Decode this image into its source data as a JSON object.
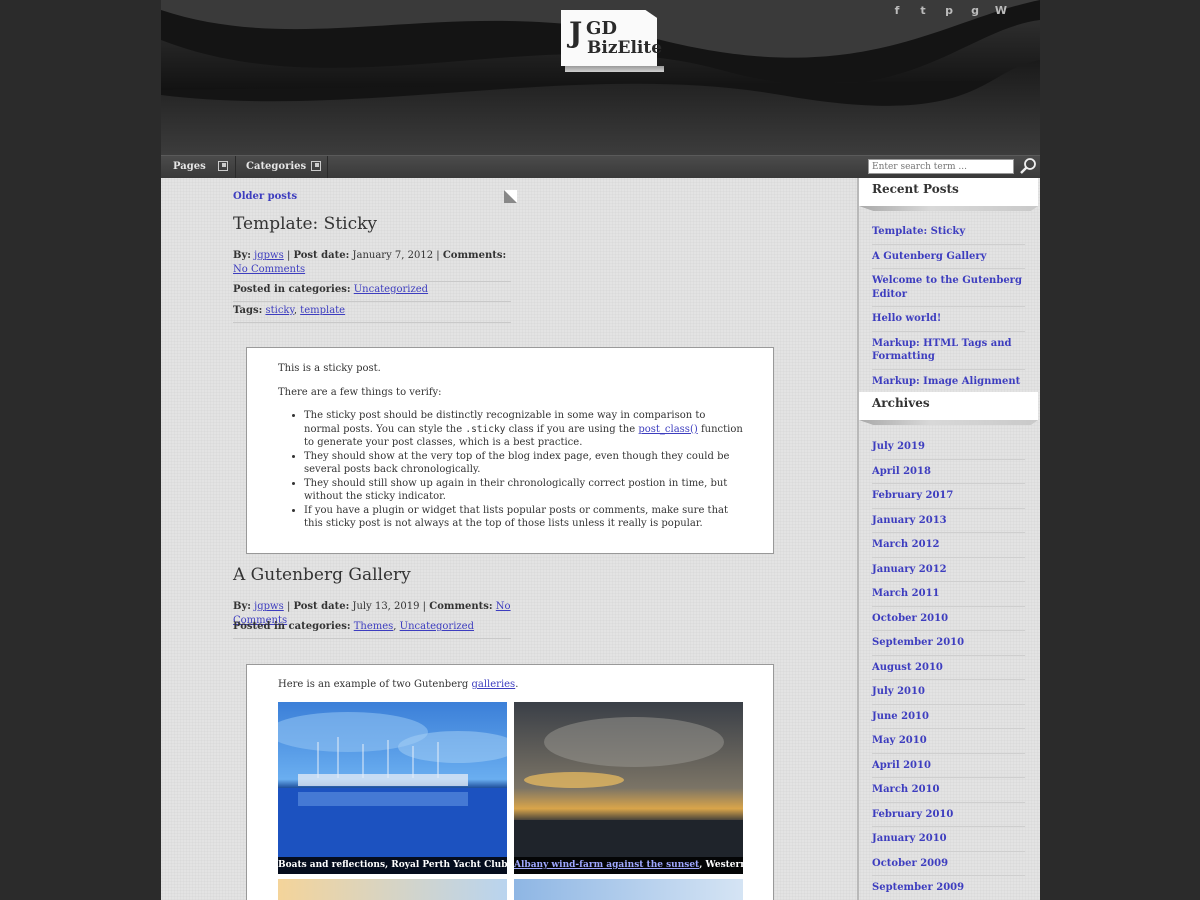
{
  "logo": {
    "j": "J",
    "gd": "GD",
    "biz": "BizElite"
  },
  "social": [
    {
      "icon": "facebook-icon",
      "glyph": "f"
    },
    {
      "icon": "twitter-icon",
      "glyph": "t"
    },
    {
      "icon": "pinterest-icon",
      "glyph": "p"
    },
    {
      "icon": "github-icon",
      "glyph": "g"
    },
    {
      "icon": "wordpress-icon",
      "glyph": "W"
    }
  ],
  "nav": {
    "pages": "Pages",
    "categories": "Categories",
    "search_placeholder": "Enter search term ..."
  },
  "content": {
    "older_posts": "Older posts",
    "post1": {
      "title": "Template: Sticky",
      "by_label": "By:",
      "author": "jgpws",
      "date_label": "Post date:",
      "date": "January 7, 2012",
      "comments_label": "Comments:",
      "comments": "No Comments",
      "categories_label": "Posted in categories:",
      "category1": "Uncategorized",
      "tags_label": "Tags:",
      "tag1": "sticky",
      "tag2": "template",
      "p1": "This is a sticky post.",
      "p2": "There are a few things to verify:",
      "li1_a": "The sticky post should be distinctly recognizable in some way in comparison to normal posts. You can style the",
      "li1_code": ".sticky",
      "li1_b": "class if you are using the",
      "li1_link": "post_class()",
      "li1_c": "function to generate your post classes, which is a best practice.",
      "li2": "They should show at the very top of the blog index page, even though they could be several posts back chronologically.",
      "li3": "They should still show up again in their chronologically correct postion in time, but without the sticky indicator.",
      "li4": "If you have a plugin or widget that lists popular posts or comments, make sure that this sticky post is not always at the top of those lists unless it really is popular."
    },
    "post2": {
      "title": "A Gutenberg Gallery",
      "by_label": "By:",
      "author": "jgpws",
      "date_label": "Post date:",
      "date": "July 13, 2019",
      "comments_label": "Comments:",
      "comments": "No Comments",
      "categories_label": "Posted in categories:",
      "category1": "Themes",
      "category2": "Uncategorized",
      "intro_a": "Here is an example of two Gutenberg",
      "intro_link": "galleries",
      "intro_b": ".",
      "caption1": "Boats and reflections, Royal Perth Yacht Club",
      "caption2_link": "Albany wind-farm against the sunset",
      "caption2_rest": ", Western Australia"
    }
  },
  "sidebar": {
    "recent_title": "Recent Posts",
    "recent": [
      "Template: Sticky",
      "A Gutenberg Gallery",
      "Welcome to the Gutenberg Editor",
      "Hello world!",
      "Markup: HTML Tags and Formatting",
      "Markup: Image Alignment"
    ],
    "archives_title": "Archives",
    "archives": [
      "July 2019",
      "April 2018",
      "February 2017",
      "January 2013",
      "March 2012",
      "January 2012",
      "March 2011",
      "October 2010",
      "September 2010",
      "August 2010",
      "July 2010",
      "June 2010",
      "May 2010",
      "April 2010",
      "March 2010",
      "February 2010",
      "January 2010",
      "October 2009",
      "September 2009"
    ]
  }
}
